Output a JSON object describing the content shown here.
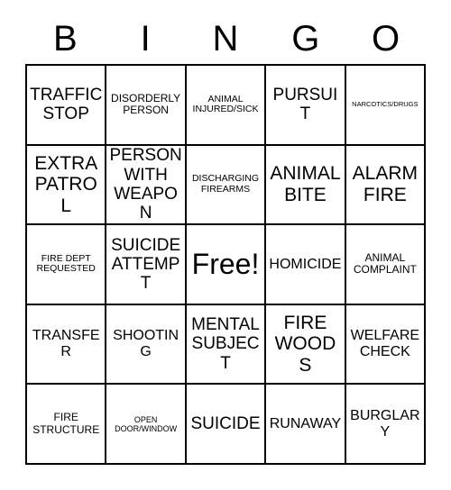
{
  "card": {
    "header_letters": [
      "B",
      "I",
      "N",
      "G",
      "O"
    ],
    "rows": [
      [
        {
          "text": "TRAFFIC STOP",
          "size": "lg"
        },
        {
          "text": "DISORDERLY PERSON",
          "size": "sm"
        },
        {
          "text": "ANIMAL INJURED/SICK",
          "size": "xs"
        },
        {
          "text": "PURSUIT",
          "size": "lg"
        },
        {
          "text": "NARCOTICS/DRUGS",
          "size": "tiny"
        }
      ],
      [
        {
          "text": "EXTRA PATROL",
          "size": "xl"
        },
        {
          "text": "PERSON WITH WEAPON",
          "size": "lg"
        },
        {
          "text": "DISCHARGING FIREARMS",
          "size": "xs"
        },
        {
          "text": "ANIMAL BITE",
          "size": "xl"
        },
        {
          "text": "ALARM FIRE",
          "size": "xl"
        }
      ],
      [
        {
          "text": "FIRE DEPT REQUESTED",
          "size": "xs"
        },
        {
          "text": "SUICIDE ATTEMPT",
          "size": "lg"
        },
        {
          "text": "Free!",
          "size": "xxl"
        },
        {
          "text": "HOMICIDE",
          "size": "md"
        },
        {
          "text": "ANIMAL COMPLAINT",
          "size": "sm"
        }
      ],
      [
        {
          "text": "TRANSFER",
          "size": "md"
        },
        {
          "text": "SHOOTING",
          "size": "md"
        },
        {
          "text": "MENTAL SUBJECT",
          "size": "lg"
        },
        {
          "text": "FIRE WOODS",
          "size": "xl"
        },
        {
          "text": "WELFARE CHECK",
          "size": "md"
        }
      ],
      [
        {
          "text": "FIRE STRUCTURE",
          "size": "sm"
        },
        {
          "text": "OPEN DOOR/WINDOW",
          "size": "xxs"
        },
        {
          "text": "SUICIDE",
          "size": "lg"
        },
        {
          "text": "RUNAWAY",
          "size": "md"
        },
        {
          "text": "BURGLARY",
          "size": "md"
        }
      ]
    ],
    "colors": {
      "text": "#000000",
      "border": "#000000",
      "background": "#ffffff"
    }
  }
}
